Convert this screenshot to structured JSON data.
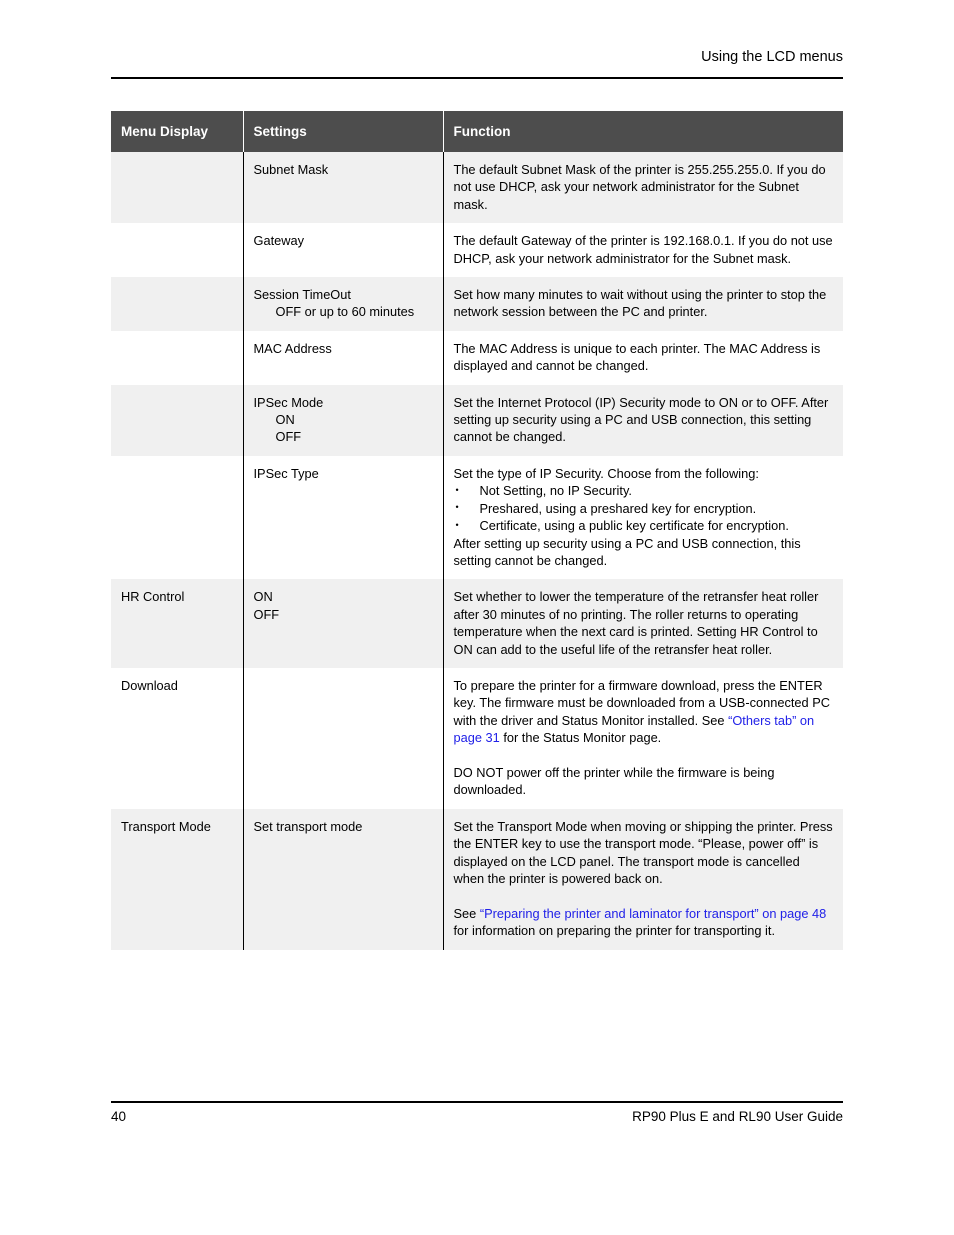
{
  "header": {
    "running_head": "Using the LCD menus"
  },
  "table": {
    "columns": [
      "Menu Display",
      "Settings",
      "Function"
    ],
    "rows": [
      {
        "shaded": true,
        "menu": "",
        "settings": "Subnet Mask",
        "settings_sub": "",
        "function": "The default Subnet Mask of the printer is 255.255.255.0. If you do not use DHCP, ask your network administrator for the Subnet mask."
      },
      {
        "shaded": false,
        "menu": "",
        "settings": "Gateway",
        "settings_sub": "",
        "function": "The default Gateway of the printer is 192.168.0.1. If you do not use DHCP, ask your network administrator for the Subnet mask."
      },
      {
        "shaded": true,
        "menu": "",
        "settings": "Session TimeOut",
        "settings_sub": "OFF or up to 60 minutes",
        "function": "Set how many minutes to wait without using the printer to stop the network session between the PC and printer."
      },
      {
        "shaded": false,
        "menu": "",
        "settings": "MAC Address",
        "settings_sub": "",
        "function": "The MAC Address is unique to each printer. The MAC Address is displayed and cannot be changed."
      },
      {
        "shaded": true,
        "menu": "",
        "settings": "IPSec Mode",
        "settings_sub": "ON",
        "settings_sub2": "OFF",
        "function": "Set the Internet Protocol (IP) Security mode to ON or to OFF. After setting up security using a PC and USB connection, this setting cannot be changed."
      },
      {
        "shaded": false,
        "menu": "",
        "settings": "IPSec Type",
        "settings_sub": "",
        "function_intro": "Set the type of IP Security. Choose from the following:",
        "function_bullets": [
          "Not Setting, no IP Security.",
          "Preshared, using a preshared key for encryption.",
          "Certificate, using a public key certificate for encryption."
        ],
        "function_outro": "After setting up security using a PC and USB connection, this setting cannot be changed."
      },
      {
        "shaded": true,
        "menu": "HR Control",
        "settings": "ON",
        "settings_sub": "OFF",
        "function": "Set whether to lower the temperature of the retransfer heat roller after 30 minutes of no printing. The roller returns to operating temperature when the next card is printed. Setting HR Control to ON can add to the useful life of the retransfer heat roller."
      },
      {
        "shaded": false,
        "menu": "Download",
        "settings": "",
        "settings_sub": "",
        "function_p1_before": "To prepare the printer for a firmware download, press the ENTER key. The firmware must be downloaded from a USB-connected PC with the driver and Status Monitor installed. See ",
        "function_p1_link": "“Others tab” on page 31",
        "function_p1_after": " for the Status Monitor page.",
        "function_p2": "DO NOT power off the printer while the firmware is being downloaded."
      },
      {
        "shaded": true,
        "menu": "Transport Mode",
        "settings": "Set transport mode",
        "settings_sub": "",
        "function_p1": "Set the Transport Mode when moving or shipping the printer. Press the ENTER key to use the transport mode. “Please, power off” is displayed on the LCD panel. The transport mode is cancelled when the printer is powered back on.",
        "function_p2_before": "See ",
        "function_p2_link": "“Preparing the printer and laminator for transport” on page 48",
        "function_p2_after": " for information on preparing the printer for transporting it."
      }
    ]
  },
  "footer": {
    "page_number": "40",
    "guide_title": "RP90 Plus E and RL90 User Guide"
  },
  "colors": {
    "header_bg": "#4d4d4d",
    "shade_bg": "#f0f0f0",
    "link": "#2121e8",
    "rule": "#000000"
  }
}
